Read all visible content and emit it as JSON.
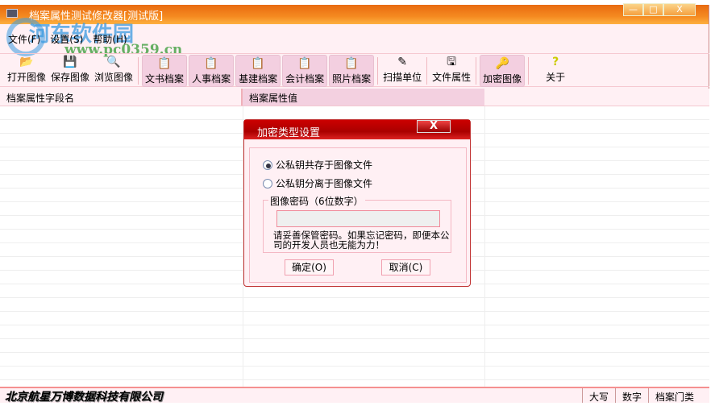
{
  "window": {
    "title": "档案属性测试修改器[测试版]",
    "min": "—",
    "max": "□",
    "close": "X"
  },
  "watermark": {
    "name": "河东软件园",
    "url": "www.pc0359.cn"
  },
  "menu": [
    "文件(F)",
    "设置(S)",
    "帮助(H)"
  ],
  "toolbar": [
    {
      "label": "打开图像",
      "icon": "📂"
    },
    {
      "label": "保存图像",
      "icon": "💾"
    },
    {
      "label": "浏览图像",
      "icon": "🔍"
    },
    {
      "label": "文书档案",
      "icon": "📋"
    },
    {
      "label": "人事档案",
      "icon": "📋"
    },
    {
      "label": "基建档案",
      "icon": "📋"
    },
    {
      "label": "会计档案",
      "icon": "📋"
    },
    {
      "label": "照片档案",
      "icon": "📋"
    },
    {
      "label": "扫描单位",
      "icon": "✎"
    },
    {
      "label": "文件属性",
      "icon": "🖫"
    },
    {
      "label": "加密图像",
      "icon": "🔑"
    },
    {
      "label": "关于",
      "icon": "?"
    }
  ],
  "grid": {
    "col1": "档案属性字段名",
    "col2": "档案属性值"
  },
  "status": {
    "company": "北京航星万博数据科技有限公司",
    "caps": "大写",
    "num": "数字",
    "category": "档案门类"
  },
  "dialog": {
    "title": "加密类型设置",
    "close": "X",
    "option1": "公私钥共存于图像文件",
    "option2": "公私钥分离于图像文件",
    "group": "图像密码（6位数字）",
    "password": "",
    "note": "请妥善保管密码。如果忘记密码，即便本公司的开发人员也无能为力！",
    "ok": "确定(O)",
    "cancel": "取消(C)"
  }
}
